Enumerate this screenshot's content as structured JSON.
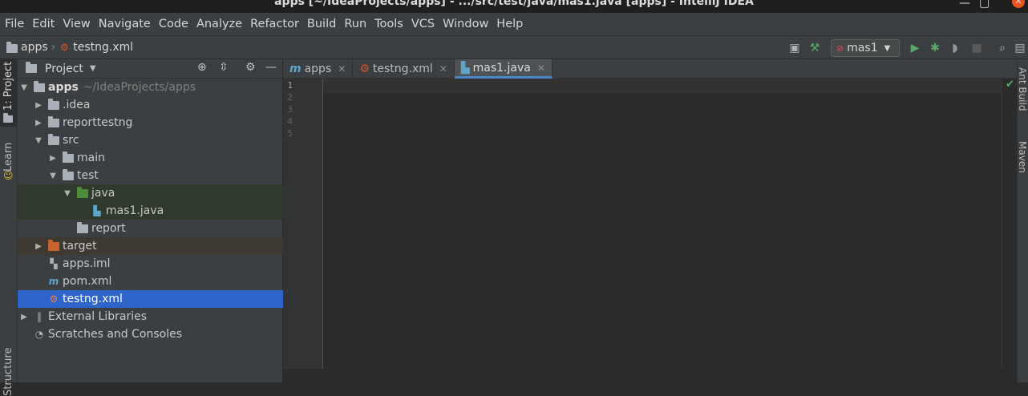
{
  "window": {
    "title": "apps [~/IdeaProjects/apps] - .../src/test/java/mas1.java [apps] - IntelliJ IDEA"
  },
  "menu": [
    "File",
    "Edit",
    "View",
    "Navigate",
    "Code",
    "Analyze",
    "Refactor",
    "Build",
    "Run",
    "Tools",
    "VCS",
    "Window",
    "Help"
  ],
  "breadcrumb": {
    "project": "apps",
    "file": "testng.xml"
  },
  "toolbar": {
    "run_config": "mas1"
  },
  "left_strip": {
    "project_tab": "1: Project",
    "learn_tab": "Learn",
    "structure_tab": "Structure"
  },
  "right_strip": {
    "ant_tab": "Ant Build",
    "maven_tab": "Maven"
  },
  "project_panel": {
    "title": "Project",
    "tree": [
      {
        "label": "apps",
        "path": "~/IdeaProjects/apps"
      },
      {
        "label": ".idea"
      },
      {
        "label": "reporttestng"
      },
      {
        "label": "src"
      },
      {
        "label": "main"
      },
      {
        "label": "test"
      },
      {
        "label": "java"
      },
      {
        "label": "mas1.java"
      },
      {
        "label": "report"
      },
      {
        "label": "target"
      },
      {
        "label": "apps.iml"
      },
      {
        "label": "pom.xml"
      },
      {
        "label": "testng.xml"
      },
      {
        "label": "External Libraries"
      },
      {
        "label": "Scratches and Consoles"
      }
    ]
  },
  "editor_tabs": [
    {
      "label": "apps"
    },
    {
      "label": "testng.xml"
    },
    {
      "label": "mas1.java"
    }
  ],
  "editor": {
    "line_numbers": [
      "1",
      "2",
      "3",
      "4",
      "5"
    ]
  },
  "colors": {
    "accent": "#2f65ca",
    "tab_underline": "#4a88c7",
    "run_green": "#59a869"
  }
}
